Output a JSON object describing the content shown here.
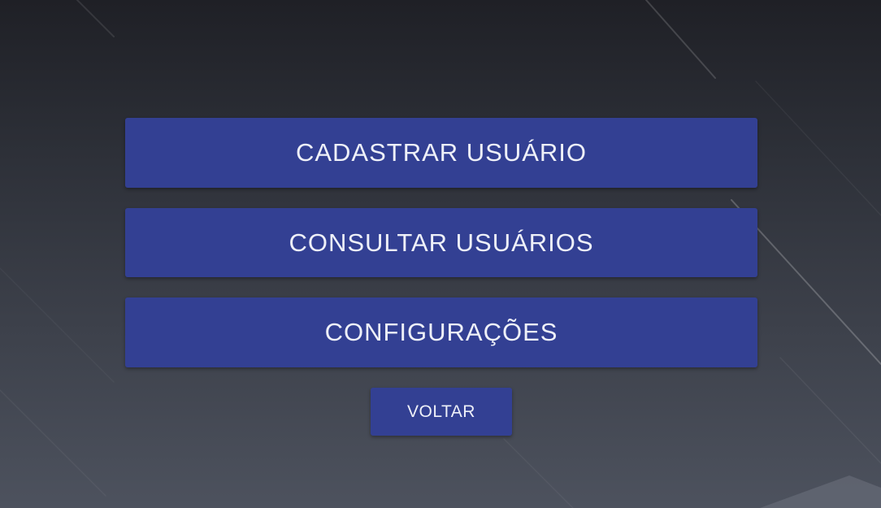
{
  "menu": {
    "items": [
      {
        "label": "CADASTRAR USUÁRIO"
      },
      {
        "label": "CONSULTAR USUÁRIOS"
      },
      {
        "label": "CONFIGURAÇÕES"
      }
    ],
    "back_label": "VOLTAR"
  },
  "colors": {
    "button_background": "#334093",
    "button_text": "#eef0f8",
    "background_top": "#1f2026",
    "background_bottom": "#4d525e"
  }
}
